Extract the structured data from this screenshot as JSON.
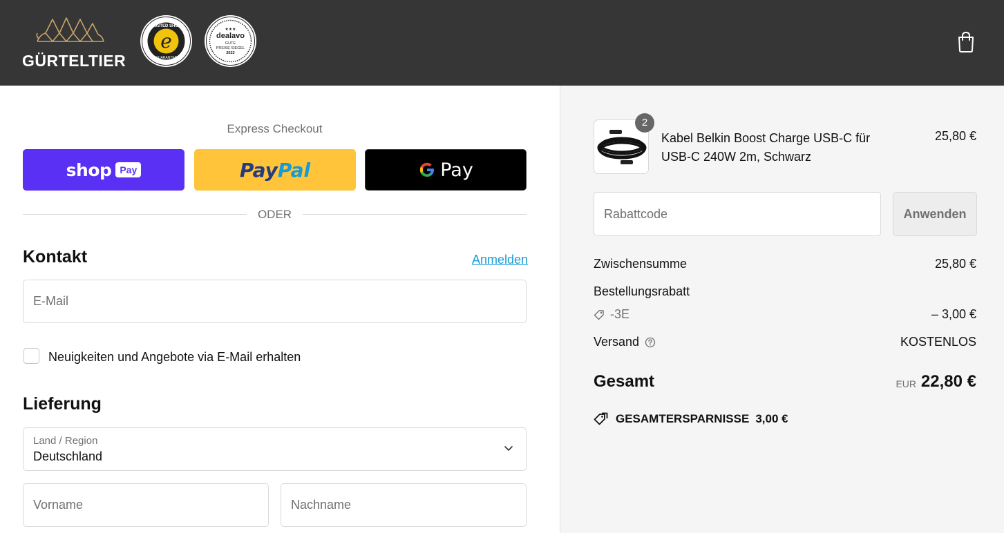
{
  "header": {
    "brand": "GÜRTELTIER",
    "badges": [
      {
        "name": "trusted-shops",
        "text_top": "TRUSTED SHOPS",
        "letter": "e",
        "text_bottom": "GUARANTEE"
      },
      {
        "name": "dealavo",
        "stars": "★★★",
        "brand": "dealavo",
        "line1": "GUTE",
        "line2": "PREISE SIEGEL",
        "year": "2023"
      }
    ],
    "cart_icon": "shopping-bag-icon"
  },
  "express": {
    "title": "Express Checkout",
    "shop_pay": {
      "word": "shop",
      "pill": "Pay"
    },
    "paypal": {
      "part1": "Pay",
      "part2": "Pal"
    },
    "gpay": {
      "word": "Pay"
    },
    "divider": "ODER"
  },
  "contact": {
    "title": "Kontakt",
    "login_link": "Anmelden",
    "email_placeholder": "E-Mail",
    "newsletter_label": "Neuigkeiten und Angebote via E-Mail erhalten"
  },
  "delivery": {
    "title": "Lieferung",
    "country_label": "Land / Region",
    "country_value": "Deutschland",
    "first_name_placeholder": "Vorname",
    "last_name_placeholder": "Nachname"
  },
  "summary": {
    "product": {
      "name": "Kabel Belkin Boost Charge USB-C für USB-C 240W 2m, Schwarz",
      "price": "25,80 €",
      "quantity": "2"
    },
    "discount_placeholder": "Rabattcode",
    "apply_label": "Anwenden",
    "subtotal_label": "Zwischensumme",
    "subtotal_value": "25,80 €",
    "order_discount_label": "Bestellungsrabatt",
    "discount_code": "-3E",
    "discount_value": "– 3,00 €",
    "shipping_label": "Versand",
    "shipping_value": "KOSTENLOS",
    "total_label": "Gesamt",
    "total_currency": "EUR",
    "total_value": "22,80 €",
    "savings_label": "GESAMTERSPARNISSE",
    "savings_value": "3,00 €"
  },
  "colors": {
    "header_bg": "#363636",
    "shop_pay": "#5a31f4",
    "paypal": "#ffc439",
    "link": "#1a9bd7",
    "summary_bg": "#f5f5f5",
    "logo_gold": "#c9a46a"
  }
}
